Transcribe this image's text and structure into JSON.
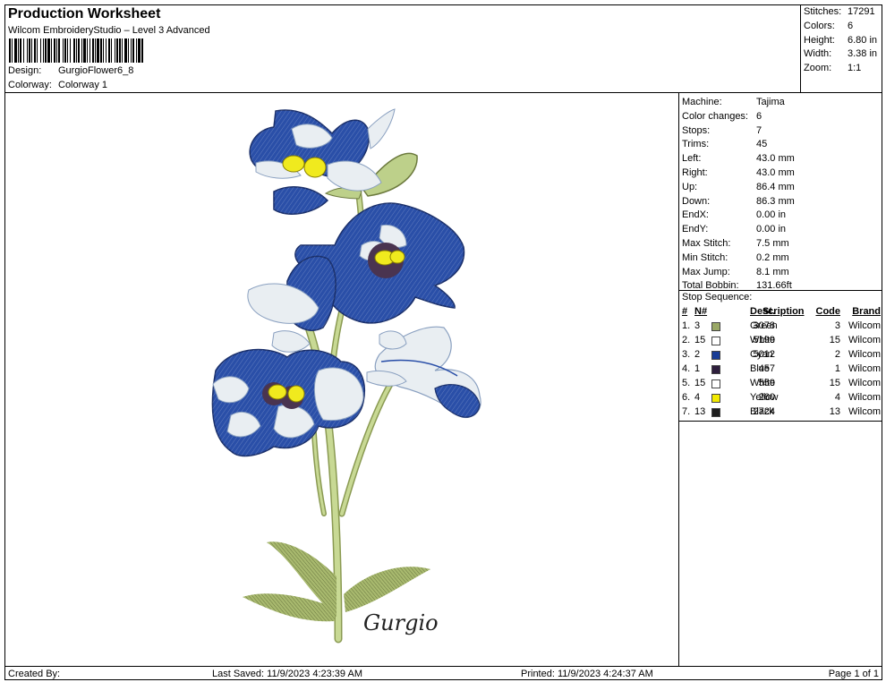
{
  "header": {
    "title": "Production Worksheet",
    "subtitle": "Wilcom EmbroideryStudio – Level 3 Advanced",
    "design_label": "Design:",
    "design_value": "GurgioFlower6_8",
    "colorway_label": "Colorway:",
    "colorway_value": "Colorway 1"
  },
  "summary": [
    {
      "label": "Stitches:",
      "value": "17291"
    },
    {
      "label": "Colors:",
      "value": "6"
    },
    {
      "label": "Height:",
      "value": "6.80 in"
    },
    {
      "label": "Width:",
      "value": "3.38 in"
    },
    {
      "label": "Zoom:",
      "value": "1:1"
    }
  ],
  "machine_info": [
    {
      "label": "Machine:",
      "value": "Tajima"
    },
    {
      "label": "Color changes:",
      "value": "6"
    },
    {
      "label": "Stops:",
      "value": "7"
    },
    {
      "label": "Trims:",
      "value": "45"
    },
    {
      "label": "Left:",
      "value": "43.0 mm"
    },
    {
      "label": "Right:",
      "value": "43.0 mm"
    },
    {
      "label": "Up:",
      "value": "86.4 mm"
    },
    {
      "label": "Down:",
      "value": "86.3 mm"
    },
    {
      "label": "EndX:",
      "value": "0.00 in"
    },
    {
      "label": "EndY:",
      "value": "0.00 in"
    },
    {
      "label": "Max Stitch:",
      "value": "7.5 mm"
    },
    {
      "label": "Min Stitch:",
      "value": "0.2 mm"
    },
    {
      "label": "Max Jump:",
      "value": "8.1 mm"
    },
    {
      "label": "Total Bobbin:",
      "value": "131.66ft"
    }
  ],
  "stop_sequence": {
    "title": "Stop Sequence:",
    "headers": {
      "num": "#",
      "n": "N#",
      "st": "St.",
      "desc": "Description",
      "code": "Code",
      "brand": "Brand"
    },
    "rows": [
      {
        "num": "1.",
        "n": "3",
        "color": "#9aa866",
        "st": "3078",
        "desc": "Green",
        "code": "3",
        "brand": "Wilcom"
      },
      {
        "num": "2.",
        "n": "15",
        "color": "#ffffff",
        "st": "5199",
        "desc": "White",
        "code": "15",
        "brand": "Wilcom"
      },
      {
        "num": "3.",
        "n": "2",
        "color": "#1a3d96",
        "st": "5012",
        "desc": "Cyan",
        "code": "2",
        "brand": "Wilcom"
      },
      {
        "num": "4.",
        "n": "1",
        "color": "#2e1f3d",
        "st": "457",
        "desc": "Blue",
        "code": "1",
        "brand": "Wilcom"
      },
      {
        "num": "5.",
        "n": "15",
        "color": "#ffffff",
        "st": "559",
        "desc": "White",
        "code": "15",
        "brand": "Wilcom"
      },
      {
        "num": "6.",
        "n": "4",
        "color": "#f2ea00",
        "st": "260",
        "desc": "Yellow",
        "code": "4",
        "brand": "Wilcom"
      },
      {
        "num": "7.",
        "n": "13",
        "color": "#1e1e1e",
        "st": "2724",
        "desc": "Black",
        "code": "13",
        "brand": "Wilcom"
      }
    ]
  },
  "design": {
    "signature": "Gurgio",
    "colors": {
      "blue": "#2a4fa8",
      "light": "#e9eef2",
      "green": "#bdd08a",
      "dark_green": "#6c7a3e",
      "yellow": "#f0ea1e",
      "eye": "#4a3450"
    }
  },
  "footer": {
    "created_by": "Created By:",
    "last_saved": "Last Saved: 11/9/2023 4:23:39 AM",
    "printed": "Printed: 11/9/2023 4:24:37 AM",
    "page": "Page 1 of 1"
  }
}
